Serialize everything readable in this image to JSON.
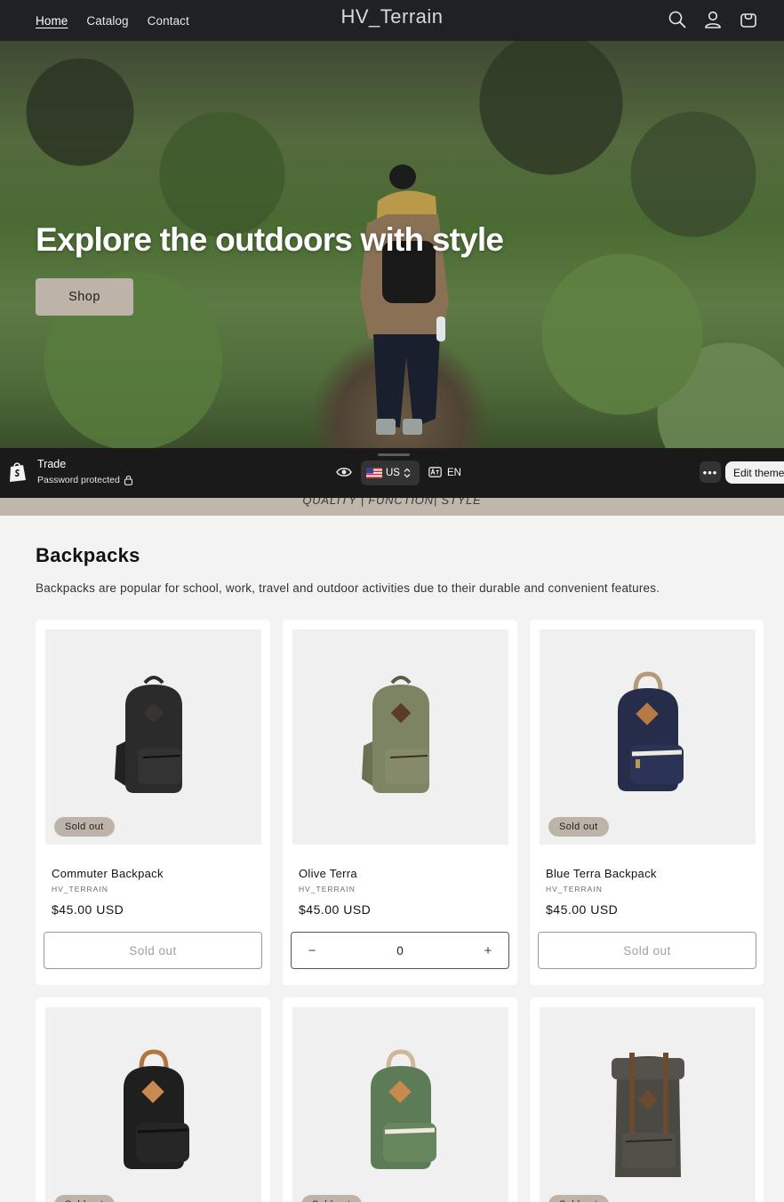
{
  "header": {
    "nav": [
      "Home",
      "Catalog",
      "Contact"
    ],
    "brand": "HV_Terrain",
    "icons": [
      "search-icon",
      "account-icon",
      "cart-icon"
    ]
  },
  "hero": {
    "title": "Explore the outdoors with style",
    "button": "Shop"
  },
  "preview_bar": {
    "store_name": "Trade",
    "store_status": "Password protected",
    "country": "US",
    "language": "EN",
    "more": "•••",
    "edit_theme": "Edit theme"
  },
  "tagline": "QUALITY | FUNCTION| STYLE",
  "collection": {
    "title": "Backpacks",
    "description": "Backpacks are popular for school, work, travel and outdoor activities due to their durable and convenient features."
  },
  "products": [
    {
      "name": "Commuter Backpack",
      "vendor": "HV_TERRAIN",
      "price": "$45.00 USD",
      "badge": "Sold out",
      "action": "Sold out",
      "color": "#2b2b2b"
    },
    {
      "name": "Olive Terra",
      "vendor": "HV_TERRAIN",
      "price": "$45.00 USD",
      "badge": "",
      "quantity": "0",
      "minus": "−",
      "plus": "+",
      "color": "#7d8463"
    },
    {
      "name": "Blue Terra Backpack",
      "vendor": "HV_TERRAIN",
      "price": "$45.00 USD",
      "badge": "Sold out",
      "action": "Sold out",
      "color": "#252d4a"
    },
    {
      "badge": "Sold out",
      "color": "#1f1f1f"
    },
    {
      "badge": "Sold out",
      "color": "#5d7b56"
    },
    {
      "badge": "Sold out",
      "color": "#4b4943"
    }
  ],
  "colors": {
    "header_bg": "#1f2122",
    "accent": "#bdb3a9",
    "page_bg": "#f3f3f3"
  }
}
